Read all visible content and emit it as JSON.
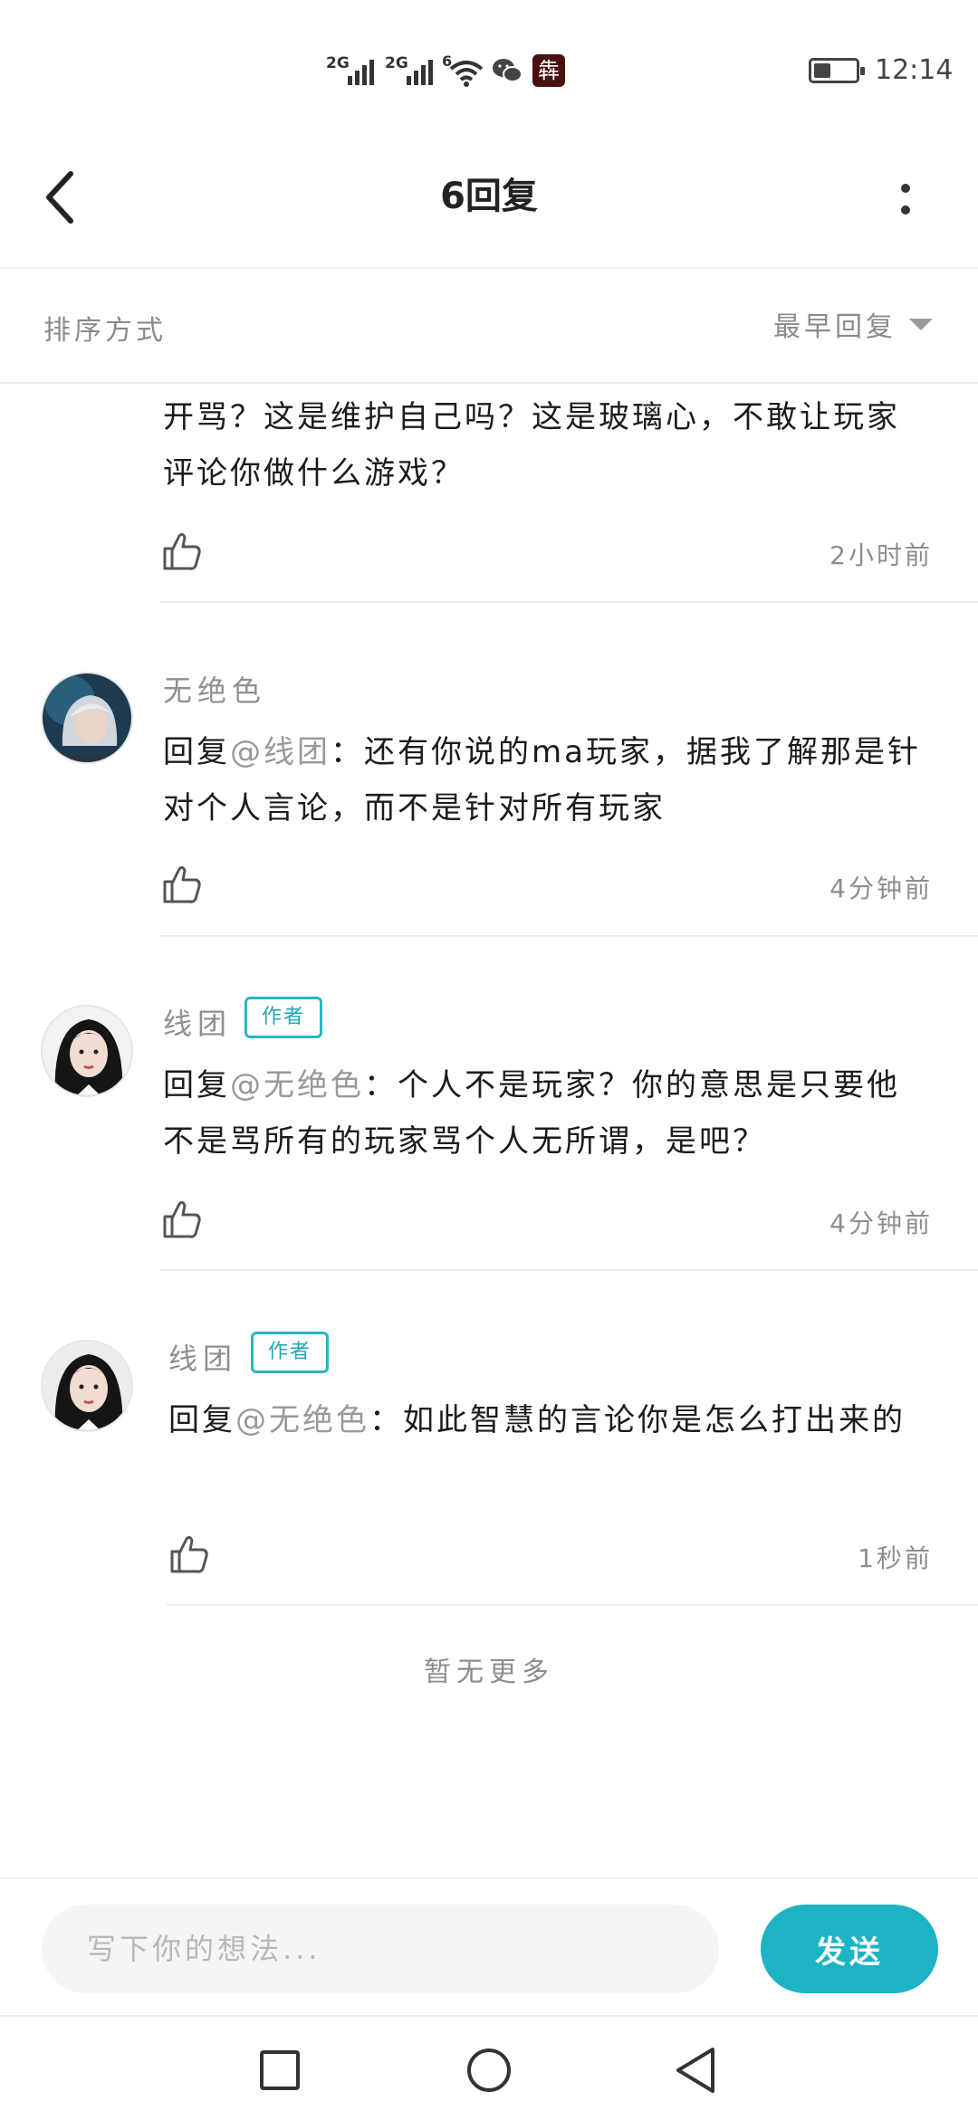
{
  "status_bar": {
    "signal1": "2G",
    "signal2": "2G",
    "wifi_badge": "6",
    "app_icon_char": "犇",
    "battery_level": 0.4,
    "time": "12:14"
  },
  "header": {
    "title": "6回复"
  },
  "sort": {
    "label": "排序方式",
    "selected": "最早回复"
  },
  "replies": [
    {
      "text": "开骂？这是维护自己吗？这是玻璃心，不敢让玩家评论你做什么游戏？",
      "time": "2小时前"
    },
    {
      "name": "无绝色",
      "prefix": "回复",
      "mention": "@线团",
      "text": "：还有你说的ma玩家，据我了解那是针对个人言论，而不是针对所有玩家",
      "time": "4分钟前"
    },
    {
      "name": "线团",
      "badge": "作者",
      "prefix": "回复",
      "mention": "@无绝色",
      "text": "：个人不是玩家？你的意思是只要他不是骂所有的玩家骂个人无所谓，是吧？",
      "time": "4分钟前"
    },
    {
      "name": "线团",
      "badge": "作者",
      "prefix": "回复",
      "mention": "@无绝色",
      "text": "：如此智慧的言论你是怎么打出来的",
      "time": "1秒前"
    }
  ],
  "footer_text": "暂无更多",
  "composer": {
    "placeholder": "写下你的想法...",
    "send_label": "发送"
  },
  "colors": {
    "accent": "#1cb4c4",
    "badge": "#2bb5c3",
    "secondary_text": "#8d8d8d"
  },
  "icons": [
    "back-arrow-icon",
    "more-vert-icon",
    "caret-down-icon",
    "thumbs-up-icon",
    "nav-square-icon",
    "nav-circle-icon",
    "nav-back-triangle-icon"
  ]
}
